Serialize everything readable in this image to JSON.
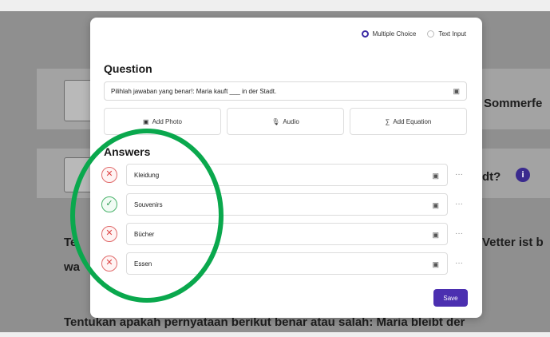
{
  "background": {
    "row1_text": "Sommerfe",
    "row2_text": "dt?",
    "row2_badge": "i",
    "row3_text_left": "Te",
    "row3_text_right": "Vetter ist b",
    "row3_line2": "wa",
    "row4_text": "Tentukan apakah pernyataan berikut benar atau salah: Maria bleibt der"
  },
  "mode": {
    "option1": "Multiple Choice",
    "option2": "Text Input",
    "selected": "Multiple Choice"
  },
  "question": {
    "title": "Question",
    "text": "Pilihlah jawaban yang benar!: Maria kauft ___ in der Stadt.",
    "input_icon": "image-icon"
  },
  "tools": {
    "photo": "Add Photo",
    "audio": "Audio",
    "equation": "Add Equation"
  },
  "answers": {
    "title": "Answers",
    "items": [
      {
        "text": "Kleidung",
        "correct": false
      },
      {
        "text": "Souvenirs",
        "correct": true
      },
      {
        "text": "Bücher",
        "correct": false
      },
      {
        "text": "Essen",
        "correct": false
      }
    ]
  },
  "save_label": "Save",
  "colors": {
    "accent": "#4b2fb0",
    "correct": "#48b26a",
    "wrong": "#e06a6a",
    "annotation": "#0aa84d"
  }
}
